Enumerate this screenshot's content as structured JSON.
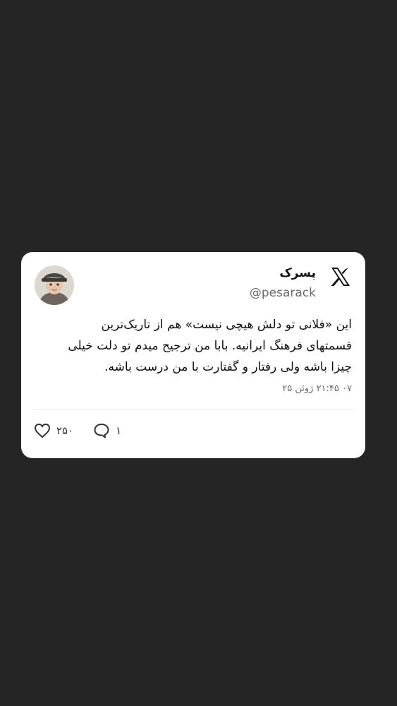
{
  "tweet": {
    "display_name": "پسرک",
    "handle": "@pesarack",
    "text": "این «فلانی تو دلش هیچی نیست» هم از تاریک‌ترین\nقسمتهای فرهنگ ایرانیه. بابا من ترجیح میدم تو دلت خیلی\nچیزا باشه ولی رفتار و گفتارت با من درست باشه.",
    "time": "۰۷ ۲۱:۴۵ ژوئن ۲۵",
    "likes": "۲۵۰",
    "replies": "۱"
  },
  "icons": {
    "brand": "x-logo-icon",
    "like": "heart-icon",
    "reply": "speech-bubble-icon"
  },
  "colors": {
    "background": "#252525",
    "card": "#ffffff",
    "text": "#111111",
    "muted": "#6b6b6b"
  }
}
